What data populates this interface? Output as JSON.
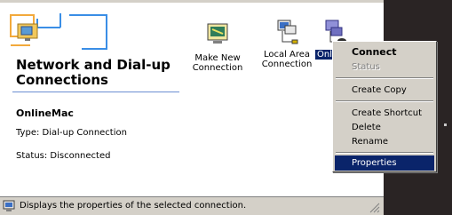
{
  "panel": {
    "title": "Network and Dial-up Connections",
    "selected_name": "OnlineMac",
    "type_text": "Type: Dial-up Connection",
    "status_text": "Status: Disconnected"
  },
  "items": [
    {
      "label": "Make New Connection",
      "icon": "make-new-connection-icon"
    },
    {
      "label": "Local Area Connection",
      "icon": "local-area-connection-icon"
    },
    {
      "label": "Onli",
      "icon": "dial-up-connection-icon"
    }
  ],
  "context_menu": {
    "items": [
      "Connect",
      "Status",
      "Create Copy",
      "Create Shortcut",
      "Delete",
      "Rename",
      "Properties"
    ],
    "default": "Connect",
    "disabled": "Status",
    "highlighted": "Properties"
  },
  "statusbar": {
    "text": "Displays the properties of the selected connection."
  },
  "colors": {
    "selection": "#0a246a",
    "face": "#d4d0c8",
    "accent_rule": "#6b8fd1",
    "folder_blue": "#3a8ee6",
    "folder_orange": "#f2a93b"
  }
}
